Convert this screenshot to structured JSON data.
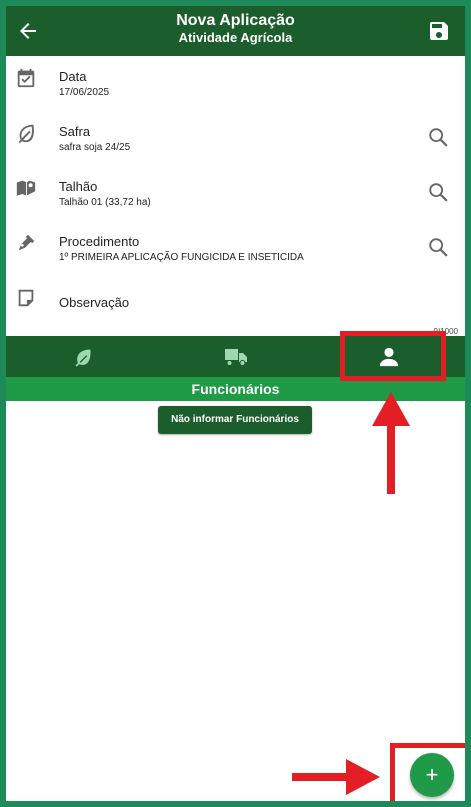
{
  "header": {
    "title": "Nova Aplicação",
    "subtitle": "Atividade Agrícola",
    "back_icon": "arrow-left-icon",
    "save_icon": "floppy-disk-icon"
  },
  "fields": {
    "data": {
      "label": "Data",
      "value": "17/06/2025",
      "icon": "calendar-check-icon"
    },
    "safra": {
      "label": "Safra",
      "value": "safra soja 24/25",
      "icon": "leaf-icon"
    },
    "talhao": {
      "label": "Talhão",
      "value": "Talhão 01 (33,72 ha)",
      "icon": "map-marker-icon"
    },
    "procedimento": {
      "label": "Procedimento",
      "value": "1º PRIMEIRA APLICAÇÃO FUNGICIDA E INSETICIDA",
      "icon": "pen-nib-icon"
    },
    "observacao": {
      "label": "Observação",
      "icon": "note-icon"
    }
  },
  "counter": "0/1000",
  "tabs": [
    {
      "icon": "leaf-icon"
    },
    {
      "icon": "truck-icon"
    },
    {
      "icon": "person-icon",
      "active": true
    }
  ],
  "section": {
    "title": "Funcionários"
  },
  "no_employees_button": "Não informar Funcionários",
  "fab_label": "+",
  "colors": {
    "primary_dark": "#1b5e2b",
    "accent": "#1f9a47",
    "frame": "#1e8a5a",
    "highlight": "#e31e24"
  }
}
